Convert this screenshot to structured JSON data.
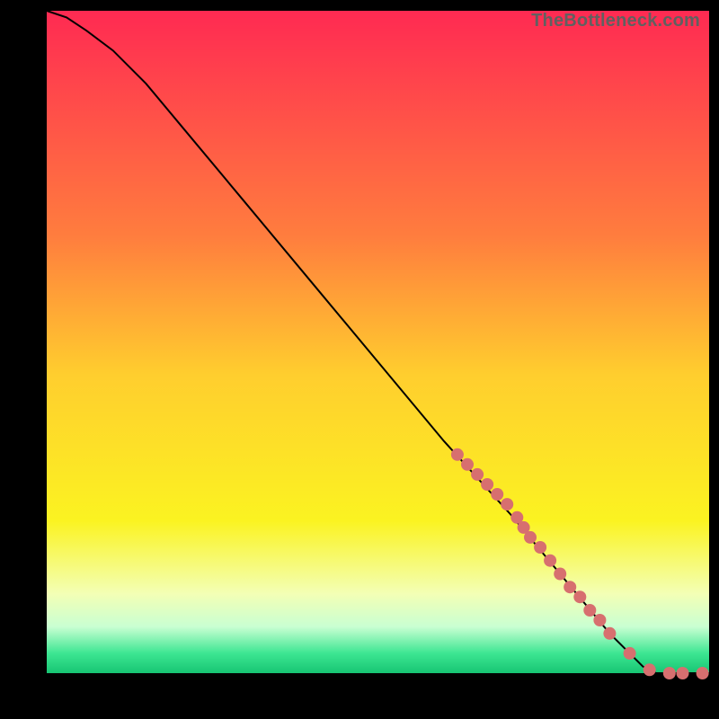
{
  "watermark": {
    "text": "TheBottleneck.com"
  },
  "colors": {
    "background": "#000000",
    "curve": "#000000",
    "marker": "#d76f6f",
    "gradient_stops": [
      {
        "pos": 0,
        "color": "#ff2a52"
      },
      {
        "pos": 34,
        "color": "#ff7d3e"
      },
      {
        "pos": 55,
        "color": "#ffce2e"
      },
      {
        "pos": 77,
        "color": "#fbf321"
      },
      {
        "pos": 88,
        "color": "#f3ffb5"
      },
      {
        "pos": 93,
        "color": "#c9ffd2"
      },
      {
        "pos": 97,
        "color": "#3de692"
      },
      {
        "pos": 100,
        "color": "#17c573"
      }
    ]
  },
  "chart_data": {
    "type": "line",
    "title": "",
    "xlabel": "",
    "ylabel": "",
    "xlim": [
      0,
      100
    ],
    "ylim": [
      0,
      100
    ],
    "series": [
      {
        "name": "curve",
        "x": [
          0,
          3,
          6,
          10,
          15,
          20,
          30,
          40,
          50,
          60,
          70,
          80,
          85,
          88,
          90,
          92,
          94,
          96,
          98,
          100
        ],
        "y": [
          100,
          99,
          97,
          94,
          89,
          83,
          71,
          59,
          47,
          35,
          24,
          12,
          6,
          3,
          1,
          0,
          0,
          0,
          0,
          0
        ]
      }
    ],
    "markers": {
      "name": "highlight-points",
      "x": [
        62,
        63.5,
        65,
        66.5,
        68,
        69.5,
        71,
        72,
        73,
        74.5,
        76,
        77.5,
        79,
        80.5,
        82,
        83.5,
        85,
        88,
        91,
        94,
        96,
        99
      ],
      "y": [
        33,
        31.5,
        30,
        28.5,
        27,
        25.5,
        23.5,
        22,
        20.5,
        19,
        17,
        15,
        13,
        11.5,
        9.5,
        8,
        6,
        3,
        0.5,
        0,
        0,
        0
      ],
      "radius": 7
    }
  }
}
